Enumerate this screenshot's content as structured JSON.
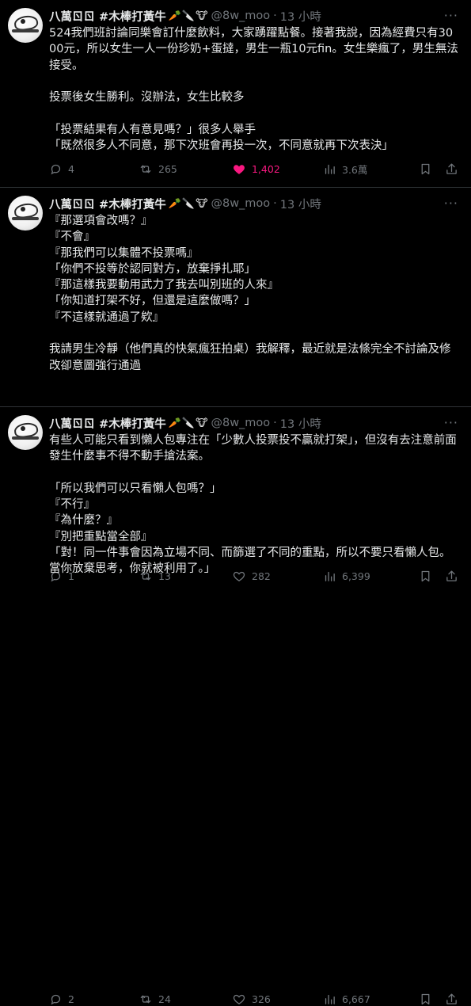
{
  "tweets": [
    {
      "author": {
        "name": "八萬ㄖㄖ #木棒打黃牛",
        "emojis": [
          "carrot-icon",
          "knife-icon",
          "cow-icon"
        ],
        "handle": "@8w_moo",
        "separator": "·",
        "time": "13 小時"
      },
      "text": "524我們班討論同樂會訂什麼飲料，大家踴躍點餐。接著我說，因為經費只有3000元，所以女生一人一份珍奶+蛋撻，男生一瓶10元fin。女生樂瘋了，男生無法接受。\n\n投票後女生勝利。沒辦法，女生比較多\n\n「投票結果有人有意見嗎？」很多人舉手\n「既然很多人不同意，那下次班會再投一次，不同意就再下次表決」",
      "stats": {
        "replies": "4",
        "reposts": "265",
        "likes": "1,402",
        "views": "3.6萬"
      },
      "liked": true
    },
    {
      "author": {
        "name": "八萬ㄖㄖ #木棒打黃牛",
        "emojis": [
          "carrot-icon",
          "knife-icon",
          "cow-icon"
        ],
        "handle": "@8w_moo",
        "separator": "·",
        "time": "13 小時"
      },
      "text": "『那選項會改嗎？』\n『不會』\n『那我們可以集體不投票嗎』\n「你們不投等於認同對方，放棄掙扎耶」\n『那這樣我要動用武力了我去叫別班的人來』\n「你知道打架不好，但還是這麼做嗎？」\n『不這樣就通過了欸』\n\n我請男生冷靜（他們真的快氣瘋狂拍桌）我解釋，最近就是法條完全不討論及修改卻意圖強行通過",
      "stats": {
        "replies": "1",
        "reposts": "13",
        "likes": "282",
        "views": "6,399"
      },
      "liked": false
    },
    {
      "author": {
        "name": "八萬ㄖㄖ #木棒打黃牛",
        "emojis": [
          "carrot-icon",
          "knife-icon",
          "cow-icon"
        ],
        "handle": "@8w_moo",
        "separator": "·",
        "time": "13 小時"
      },
      "text": "有些人可能只看到懶人包專注在「少數人投票投不贏就打架」，但沒有去注意前面發生什麼事不得不動手搶法案。\n\n「所以我們可以只看懶人包嗎？」\n『不行』\n『為什麼？』\n『別把重點當全部』\n「對！同一件事會因為立場不同、而篩選了不同的重點，所以不要只看懶人包。當你放棄思考，你就被利用了。」",
      "stats": {
        "replies": "2",
        "reposts": "24",
        "likes": "326",
        "views": "6,667"
      },
      "liked": false
    }
  ],
  "colors": {
    "background": "#000000",
    "text": "#e7e9ea",
    "muted": "#71767b",
    "like": "#f91880",
    "divider": "#2f3336"
  }
}
